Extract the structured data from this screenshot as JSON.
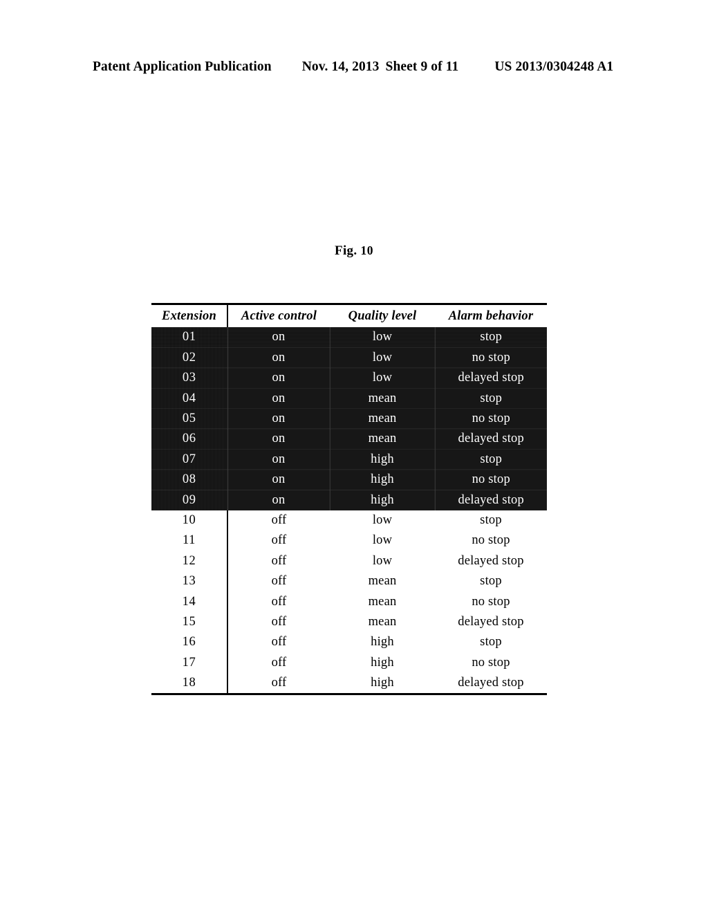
{
  "header": {
    "publication": "Patent Application Publication",
    "date": "Nov. 14, 2013",
    "sheet": "Sheet 9 of 11",
    "patent_number": "US 2013/0304248 A1"
  },
  "figure": {
    "caption_prefix": "Fig.",
    "caption_number": "10"
  },
  "table": {
    "columns": [
      "Extension",
      "Active control",
      "Quality level",
      "Alarm behavior"
    ],
    "rows": [
      {
        "extension": "01",
        "active_control": "on",
        "quality_level": "low",
        "alarm_behavior": "stop",
        "highlighted": true
      },
      {
        "extension": "02",
        "active_control": "on",
        "quality_level": "low",
        "alarm_behavior": "no stop",
        "highlighted": true
      },
      {
        "extension": "03",
        "active_control": "on",
        "quality_level": "low",
        "alarm_behavior": "delayed stop",
        "highlighted": true
      },
      {
        "extension": "04",
        "active_control": "on",
        "quality_level": "mean",
        "alarm_behavior": "stop",
        "highlighted": true
      },
      {
        "extension": "05",
        "active_control": "on",
        "quality_level": "mean",
        "alarm_behavior": "no stop",
        "highlighted": true
      },
      {
        "extension": "06",
        "active_control": "on",
        "quality_level": "mean",
        "alarm_behavior": "delayed stop",
        "highlighted": true
      },
      {
        "extension": "07",
        "active_control": "on",
        "quality_level": "high",
        "alarm_behavior": "stop",
        "highlighted": true
      },
      {
        "extension": "08",
        "active_control": "on",
        "quality_level": "high",
        "alarm_behavior": "no stop",
        "highlighted": true
      },
      {
        "extension": "09",
        "active_control": "on",
        "quality_level": "high",
        "alarm_behavior": "delayed stop",
        "highlighted": true
      },
      {
        "extension": "10",
        "active_control": "off",
        "quality_level": "low",
        "alarm_behavior": "stop",
        "highlighted": false
      },
      {
        "extension": "11",
        "active_control": "off",
        "quality_level": "low",
        "alarm_behavior": "no stop",
        "highlighted": false
      },
      {
        "extension": "12",
        "active_control": "off",
        "quality_level": "low",
        "alarm_behavior": "delayed stop",
        "highlighted": false
      },
      {
        "extension": "13",
        "active_control": "off",
        "quality_level": "mean",
        "alarm_behavior": "stop",
        "highlighted": false
      },
      {
        "extension": "14",
        "active_control": "off",
        "quality_level": "mean",
        "alarm_behavior": "no stop",
        "highlighted": false
      },
      {
        "extension": "15",
        "active_control": "off",
        "quality_level": "mean",
        "alarm_behavior": "delayed stop",
        "highlighted": false
      },
      {
        "extension": "16",
        "active_control": "off",
        "quality_level": "high",
        "alarm_behavior": "stop",
        "highlighted": false
      },
      {
        "extension": "17",
        "active_control": "off",
        "quality_level": "high",
        "alarm_behavior": "no stop",
        "highlighted": false
      },
      {
        "extension": "18",
        "active_control": "off",
        "quality_level": "high",
        "alarm_behavior": "delayed stop",
        "highlighted": false
      }
    ]
  },
  "colors": {
    "page_background": "#ffffff",
    "text": "#000000",
    "highlight_background": "#0a0a0a",
    "highlight_text": "#ffffff",
    "rule": "#000000"
  }
}
